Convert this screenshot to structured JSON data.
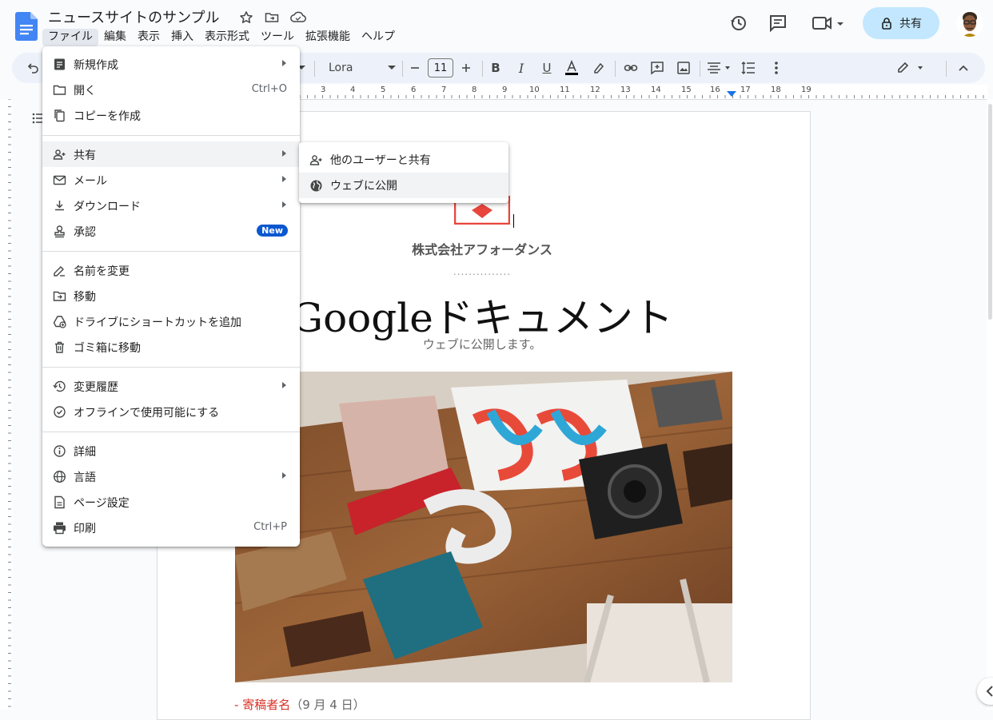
{
  "doc": {
    "title": "ニュースサイトのサンプル",
    "company": "株式会社アフォーダンス",
    "dots": "...............",
    "heading": "Googleドキュメント",
    "subtitle": "ウェブに公開します。",
    "byline_prefix": "- ",
    "byline_name": "寄稿者名",
    "byline_date": "（9 月 4 日）"
  },
  "menubar": [
    "ファイル",
    "編集",
    "表示",
    "挿入",
    "表示形式",
    "ツール",
    "拡張機能",
    "ヘルプ"
  ],
  "header": {
    "share_label": "共有"
  },
  "toolbar": {
    "font_name": "Lora",
    "font_size": "11"
  },
  "ruler": {
    "numbers": [
      "3",
      "4",
      "5",
      "6",
      "7",
      "8",
      "9",
      "10",
      "11",
      "12",
      "13",
      "14",
      "15",
      "16",
      "17",
      "18",
      "19"
    ]
  },
  "file_menu": {
    "new": "新規作成",
    "open": "開く",
    "open_shortcut": "Ctrl+O",
    "copy": "コピーを作成",
    "share": "共有",
    "email": "メール",
    "download": "ダウンロード",
    "approval": "承認",
    "approval_badge": "New",
    "rename": "名前を変更",
    "move": "移動",
    "shortcut": "ドライブにショートカットを追加",
    "trash": "ゴミ箱に移動",
    "history": "変更履歴",
    "offline": "オフラインで使用可能にする",
    "details": "詳細",
    "language": "言語",
    "page_setup": "ページ設定",
    "print": "印刷",
    "print_shortcut": "Ctrl+P"
  },
  "share_submenu": {
    "share_others": "他のユーザーと共有",
    "publish_web": "ウェブに公開"
  },
  "colors": {
    "accent": "#0b57d0",
    "share_bg": "#c2e7ff",
    "docs_blue": "#4285f4",
    "red": "#d93025"
  }
}
